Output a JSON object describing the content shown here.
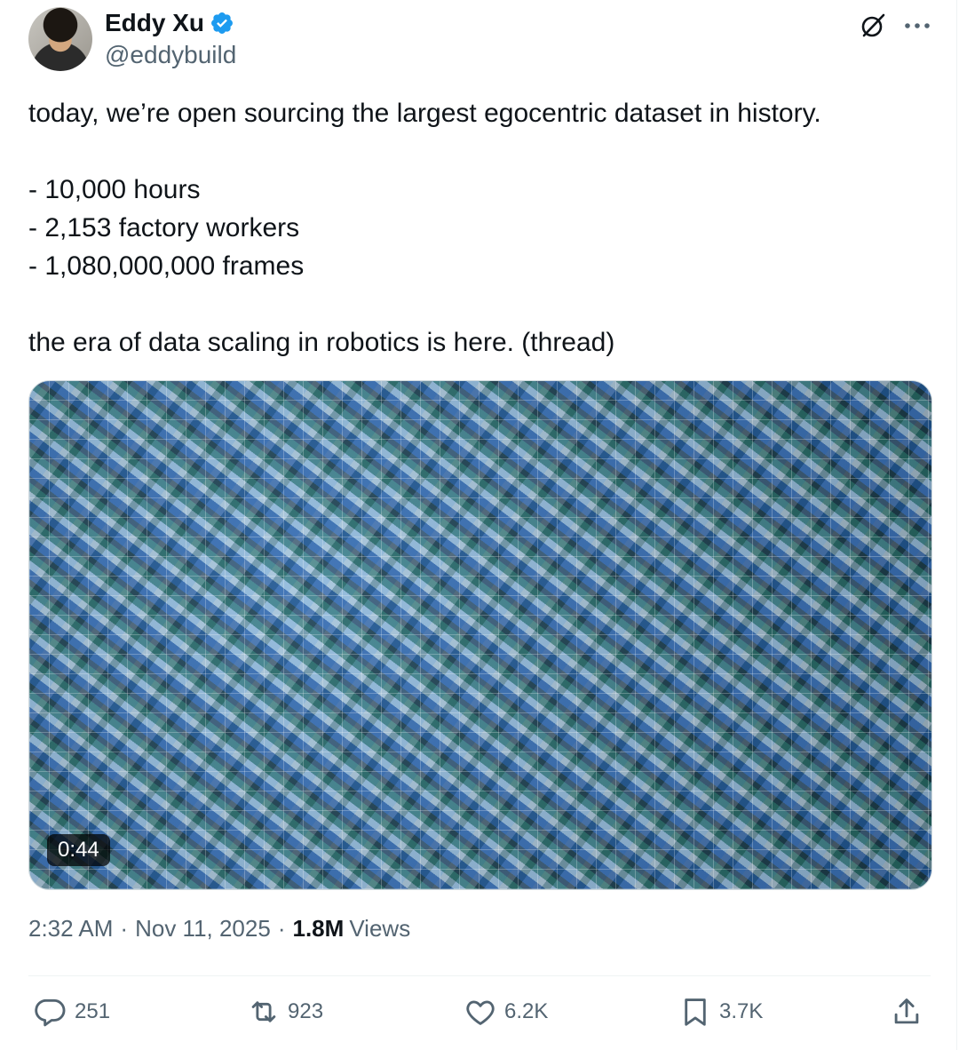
{
  "author": {
    "name": "Eddy Xu",
    "handle": "@eddybuild"
  },
  "icons": {
    "verified": "verified-badge-icon",
    "grok": "grok-icon",
    "more": "more-icon",
    "reply": "reply-icon",
    "repost": "repost-icon",
    "like": "like-icon",
    "bookmark": "bookmark-icon",
    "share": "share-icon"
  },
  "tweet": {
    "text": "today, we’re open sourcing the largest egocentric dataset in history.\n\n- 10,000 hours\n- 2,153 factory workers\n- 1,080,000,000 frames\n\nthe era of data scaling in robotics is here. (thread)"
  },
  "media": {
    "duration": "0:44"
  },
  "meta": {
    "time": "2:32 AM",
    "date": "Nov 11, 2025",
    "views_count": "1.8M",
    "views_label": "Views",
    "separator": "·"
  },
  "actions": {
    "replies": "251",
    "reposts": "923",
    "likes": "6.2K",
    "bookmarks": "3.7K"
  },
  "colors": {
    "text": "#0f1419",
    "secondary": "#536471",
    "verified": "#1d9bf0",
    "border": "#eff3f4"
  }
}
